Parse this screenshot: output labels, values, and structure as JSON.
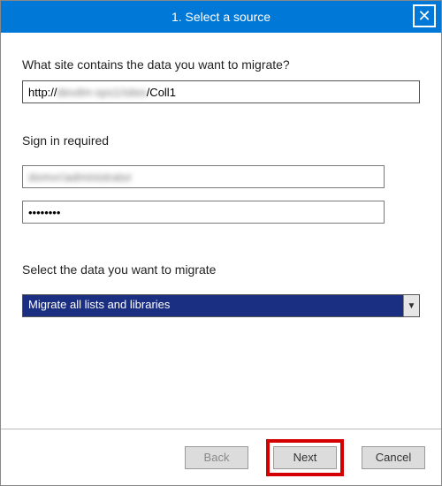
{
  "titlebar": {
    "title": "1. Select a source",
    "close_glyph": "✕"
  },
  "questions": {
    "site_label": "What site contains the data you want to migrate?",
    "url_prefix": "http://",
    "url_hidden": "devdm-sps1/sites",
    "url_suffix": "/Coll1",
    "signin_label": "Sign in required",
    "username_hidden": "domvc\\administrator",
    "password_value": "••••••••",
    "select_label": "Select the data you want to migrate",
    "select_value": "Migrate all lists and libraries"
  },
  "buttons": {
    "back": "Back",
    "next": "Next",
    "cancel": "Cancel"
  }
}
